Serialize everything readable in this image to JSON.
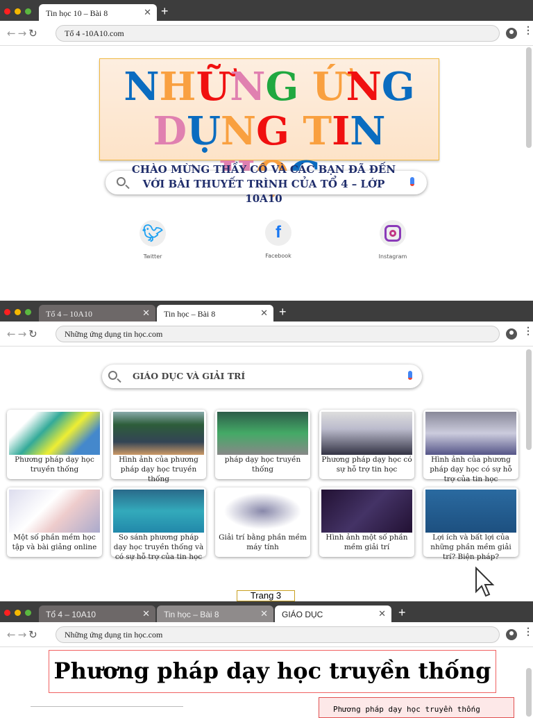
{
  "colors": {
    "traffic": [
      "#ff2020",
      "#f5b800",
      "#5bb840"
    ],
    "title_blue": "#0a6cc0",
    "title_orange": "#f9a040",
    "title_red": "#f01010",
    "title_pink": "#e080b0",
    "title_green": "#20a840"
  },
  "window1": {
    "tabs": [
      {
        "label": "Tin học 10 – Bài 8"
      }
    ],
    "url": "Tổ 4 -10A10.com",
    "title_words": [
      [
        "N",
        "H",
        "Ữ",
        "N",
        "G"
      ],
      [
        "Ứ",
        "N",
        "G"
      ],
      [
        "D",
        "Ụ",
        "N",
        "G"
      ],
      [
        "T",
        "I",
        "N"
      ],
      [
        "H",
        "Ọ",
        "C"
      ]
    ],
    "welcome": "CHÀO MỪNG THẦY CÔ VÀ CÁC BẠN ĐÃ ĐẾN VỚI BÀI THUYẾT TRÌNH CỦA TỔ 4 – LỚP 10A10",
    "social": [
      {
        "label": "Twitter",
        "icon": "twitter-icon"
      },
      {
        "label": "Facebook",
        "icon": "facebook-icon"
      },
      {
        "label": "Instagram",
        "icon": "instagram-icon"
      }
    ]
  },
  "window2": {
    "tabs": [
      {
        "label": "Tổ 4 – 10A10"
      },
      {
        "label": "Tin học – Bài 8"
      }
    ],
    "url": "Những ứng dụng tin học.com",
    "search": "GIÁO DỤC VÀ GIẢI TRÍ",
    "cards": [
      {
        "caption": "Phương pháp dạy học truyền thống"
      },
      {
        "caption": "Hình ảnh của phương pháp dạy học truyền thống"
      },
      {
        "caption": "pháp dạy học truyền thống"
      },
      {
        "caption": "Phương pháp dạy học có sự hỗ trợ tin học"
      },
      {
        "caption": "Hình ảnh của phương pháp dạy học có sự hỗ trợ của tin học"
      },
      {
        "caption": "Một số phần mềm học tập và bài giảng online"
      },
      {
        "caption": "So sánh phương pháp dạy học truyền thống và có sự hỗ trợ của tin học"
      },
      {
        "caption": "Giải trí bằng phần mềm máy tính"
      },
      {
        "caption": "Hình ảnh một số phần mềm giải trí"
      },
      {
        "caption": "Lợi ích và bất lợi của những phần mềm giải trí? Biện pháp?"
      }
    ],
    "page_label": "Trang 3"
  },
  "window3": {
    "tabs": [
      {
        "label": "Tổ 4 – 10A10"
      },
      {
        "label": "Tin học – Bài 8"
      },
      {
        "label": "GIÁO DỤC"
      }
    ],
    "url": "Những ứng dụng tin học.com",
    "heading": "Phương pháp dạy học truyền thống",
    "side_text": "Phương pháp dạy học truyền thống"
  }
}
